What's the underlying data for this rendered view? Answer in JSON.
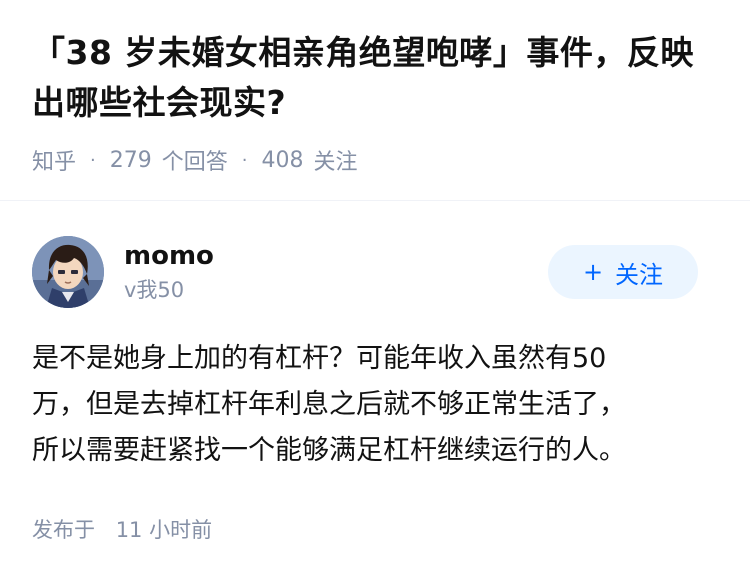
{
  "question": {
    "title": "「38 岁未婚女相亲角绝望咆哮」事件，反映出哪些社会现实?",
    "source": "知乎",
    "answer_count": "279",
    "answer_label": "个回答",
    "follower_count": "408",
    "follower_label": "关注"
  },
  "answer": {
    "author": {
      "name": "momo",
      "level": "v我50",
      "avatar_icon": "anime-character-avatar"
    },
    "follow_button": {
      "label": "关注",
      "icon": "plus-icon"
    },
    "content_lines": [
      "是不是她身上加的有杠杆？可能年收入虽然有50",
      "万，但是去掉杠杆年利息之后就不够正常生活了，",
      "所以需要赶紧找一个能够满足杠杆继续运行的人。"
    ],
    "published_label": "发布于",
    "published_time": "11 小时前"
  },
  "colors": {
    "accent": "#0066ff",
    "accent_bg": "#ebf5ff",
    "meta_text": "#8590a6",
    "title_text": "#121212"
  }
}
